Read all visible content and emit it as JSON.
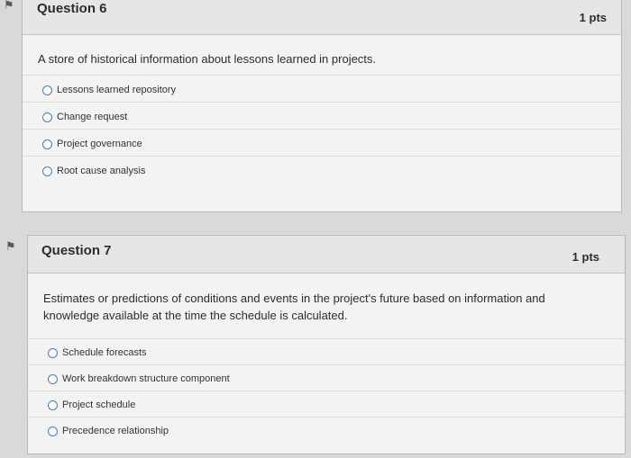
{
  "q6": {
    "title": "Question 6",
    "points": "1 pts",
    "text": "A store of historical information about lessons learned in projects.",
    "answers": [
      "Lessons learned repository",
      "Change request",
      "Project governance",
      "Root cause analysis"
    ]
  },
  "q7": {
    "title": "Question 7",
    "points": "1 pts",
    "text": "Estimates or predictions of conditions and events in the project's future based on information and knowledge available at the time the schedule is calculated.",
    "answers": [
      "Schedule forecasts",
      "Work breakdown structure component",
      "Project schedule",
      "Precedence relationship"
    ]
  },
  "icons": {
    "flag": "flag-icon"
  }
}
